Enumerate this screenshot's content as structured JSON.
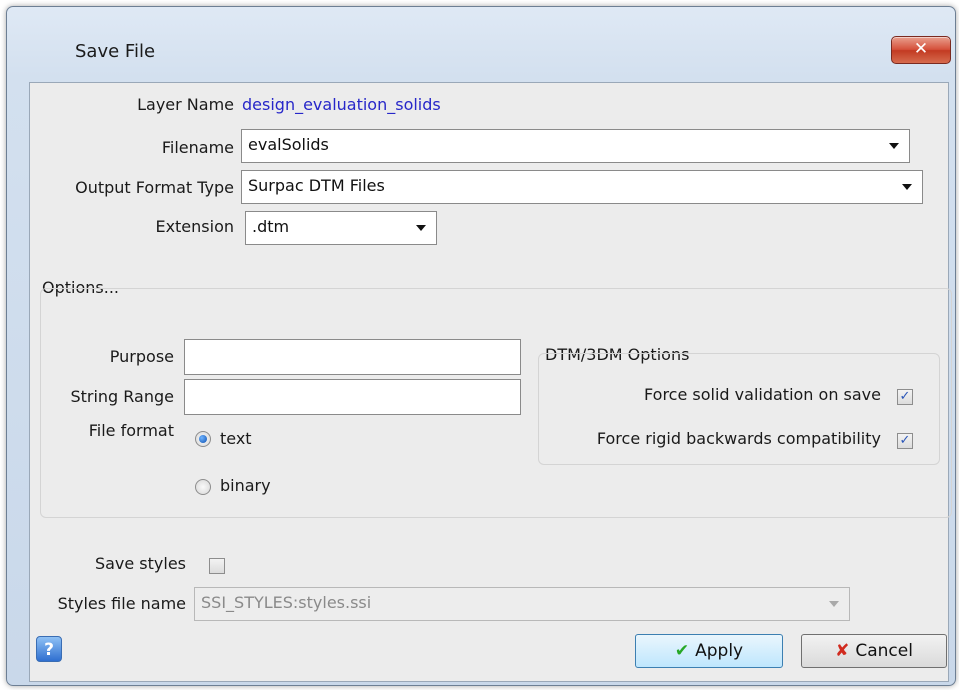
{
  "window": {
    "title": "Save File",
    "close_glyph": "✕"
  },
  "form": {
    "layer_name_label": "Layer Name",
    "layer_name_value": "design_evaluation_solids",
    "filename_label": "Filename",
    "filename_value": "evalSolids",
    "output_format_label": "Output Format Type",
    "output_format_value": "Surpac DTM Files",
    "extension_label": "Extension",
    "extension_value": ".dtm"
  },
  "options": {
    "group_title": "Options...",
    "purpose_label": "Purpose",
    "purpose_value": "",
    "string_range_label": "String Range",
    "string_range_value": "",
    "file_format_label": "File format",
    "radio_text": "text",
    "radio_binary": "binary",
    "selected_format": "text"
  },
  "dtm": {
    "group_title": "DTM/3DM Options",
    "force_validation_label": "Force solid validation on save",
    "force_validation_checked": true,
    "force_backwards_label": "Force rigid backwards compatibility",
    "force_backwards_checked": true,
    "check_glyph": "✓"
  },
  "styles": {
    "save_styles_label": "Save styles",
    "save_styles_checked": false,
    "file_name_label": "Styles file name",
    "file_name_value": "SSI_STYLES:styles.ssi"
  },
  "footer": {
    "help_glyph": "?",
    "apply_label": "Apply",
    "cancel_label": "Cancel",
    "apply_icon_glyph": "✔",
    "cancel_icon_glyph": "✘"
  },
  "colors": {
    "link_blue": "#2727c9",
    "apply_border": "#3c7fb1"
  }
}
